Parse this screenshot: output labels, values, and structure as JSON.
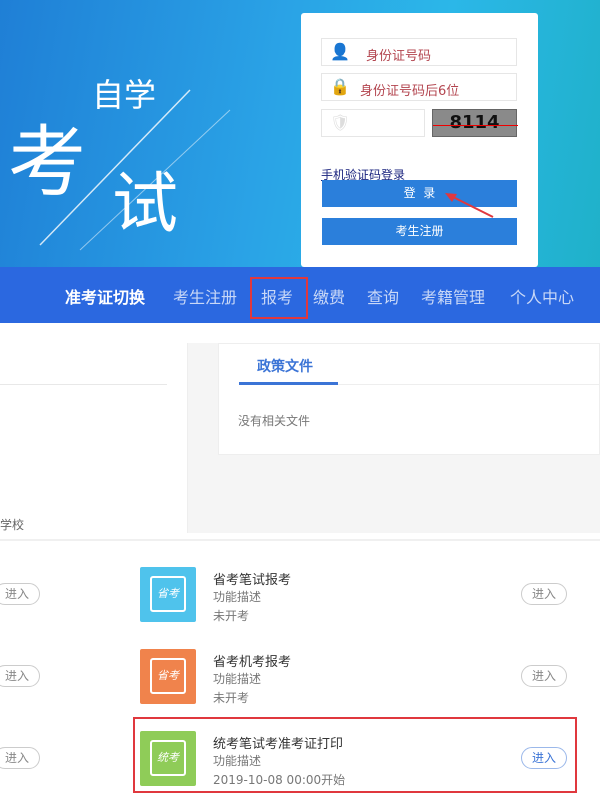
{
  "banner": {
    "art_small": "自学",
    "art_big1": "考",
    "art_big2": "试"
  },
  "login": {
    "id_placeholder": "身份证号码",
    "password_placeholder": "身份证号码后6位",
    "captcha_code": "8114",
    "sms_login_link": "手机验证码登录",
    "login_button": "登  录",
    "register_button": "考生注册"
  },
  "nav": {
    "items": [
      {
        "label": "准考证切换"
      },
      {
        "label": "考生注册"
      },
      {
        "label": "报考"
      },
      {
        "label": "缴费"
      },
      {
        "label": "查询"
      },
      {
        "label": "考籍管理"
      },
      {
        "label": "个人中心"
      }
    ],
    "highlighted": "报考"
  },
  "left_panel": {
    "text": "学校"
  },
  "policy": {
    "tab": "政策文件",
    "empty": "没有相关文件"
  },
  "list": [
    {
      "title": "省考笔试报考",
      "desc": "功能描述",
      "status": "未开考",
      "icon": "notebook-pen-icon",
      "color": "#4fc3ec",
      "icon_text": "省考",
      "enter": "进入"
    },
    {
      "title": "省考机考报考",
      "desc": "功能描述",
      "status": "未开考",
      "icon": "monitor-icon",
      "color": "#f0834c",
      "icon_text": "省考",
      "enter": "进入"
    },
    {
      "title": "统考笔试考准考证打印",
      "desc": "功能描述",
      "status": "2019-10-08 00:00开始",
      "icon": "notebook-pen-icon",
      "color": "#8fcc58",
      "icon_text": "统考",
      "enter": "进入"
    }
  ],
  "left_enter": "进入",
  "colors": {
    "nav": "#2b68e0",
    "button": "#2b7fdb",
    "highlight": "#e0383e"
  }
}
